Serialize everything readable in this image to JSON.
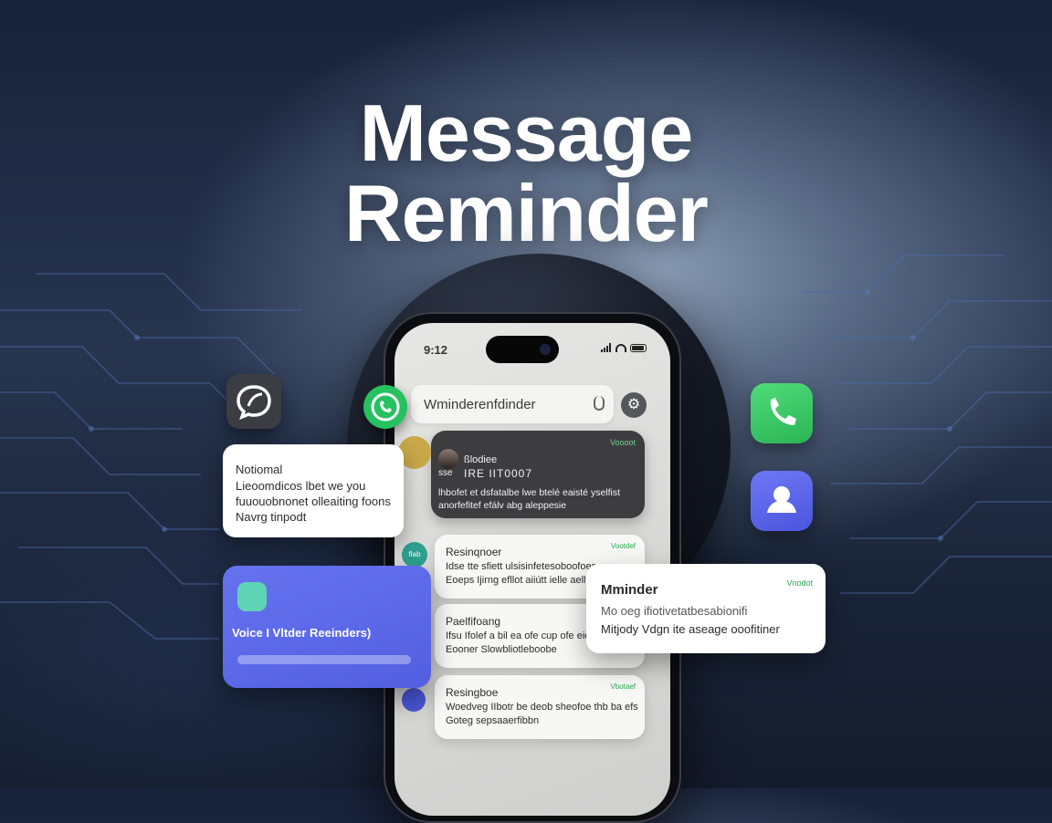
{
  "headline": {
    "line1": "Message",
    "line2": "Reminder"
  },
  "phone": {
    "status_time": "9:12",
    "search_text": "Wminderenfdinder",
    "dark_card": {
      "tag": "Voooot",
      "name": "ßlodiee",
      "subject_prefix": "sse",
      "subject": "IRE IIT0007",
      "body_line1": "lhbofet et dsfatalbe lwe btelé eaisté yselfist",
      "body_line2": "anorfefitef efálv abg aleppesie"
    },
    "cards": [
      {
        "title": "Resinqnoer",
        "tag": "Vootdef",
        "line1": "Idse tte sfiett ulsisinfetesoboofoes",
        "line2": "Eoeps Ijirng efllot aiiútt ielle aellfecoon",
        "dot_label": "flab"
      },
      {
        "title": "Paelfifoang",
        "tag": "",
        "line1": "Ifsu Ifolef a bil ea ofe cup ofe eiovo",
        "line2": "Eooner Slowbliotleboobe",
        "dot_label": ""
      },
      {
        "title": "Resingboe",
        "tag": "Vbotaef",
        "line1": "Woedveg IIbotr be deob sheofoe thb ba efs",
        "line2": "Goteg sepsaaerfibbn",
        "dot_label": ""
      }
    ]
  },
  "float_notification": {
    "title": "Notiomal",
    "line1": "Lieoomdicos lbet we you",
    "line2": "fuuouobnonet olleaiting foons",
    "line3": "Navrg tinpodt"
  },
  "voice_card": {
    "label": "Voice I Vltder Reeinders)"
  },
  "reminder_card": {
    "title": "Mminder",
    "tag": "Vnodot",
    "line1": "Mo oeg   ifiotivetatbesabionifi",
    "line2": "Mitjody  Vdgn ite aseage ooofitiner"
  },
  "icons": {
    "left_app": "chat-bubble-icon",
    "phone_app": "phone-icon",
    "contacts_app": "contact-icon",
    "whatsapp": "whatsapp-icon"
  },
  "colors": {
    "phone_green": "#34c862",
    "contact_blue": "#5b63e8",
    "voice_card": "#5a66ea",
    "whatsapp_green": "#25c25f"
  }
}
